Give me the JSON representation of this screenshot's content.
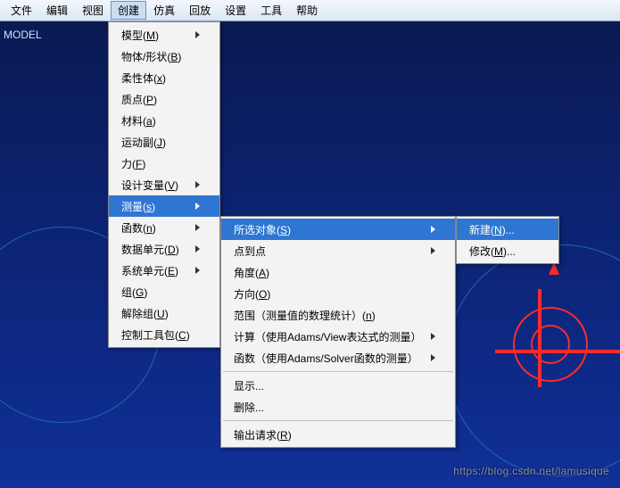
{
  "menubar": {
    "file": "文件",
    "edit": "编辑",
    "view": "视图",
    "create": "创建",
    "simulate": "仿真",
    "playback": "回放",
    "settings": "设置",
    "tools": "工具",
    "help": "帮助"
  },
  "viewport": {
    "model_label": "MODEL"
  },
  "menu_create": {
    "model": {
      "label": "模型",
      "accel": "M"
    },
    "body": {
      "label": "物体/形状",
      "accel": "B"
    },
    "flex": {
      "label": "柔性体",
      "accel": "x"
    },
    "point": {
      "label": "质点",
      "accel": "P"
    },
    "material": {
      "label": "材料",
      "accel": "a"
    },
    "joint": {
      "label": "运动副",
      "accel": "J"
    },
    "force": {
      "label": "力",
      "accel": "F"
    },
    "design_var": {
      "label": "设计变量",
      "accel": "V"
    },
    "measure": {
      "label": "测量",
      "accel": "s"
    },
    "function": {
      "label": "函数",
      "accel": "n"
    },
    "data_elem": {
      "label": "数据单元",
      "accel": "D"
    },
    "sys_elem": {
      "label": "系统单元",
      "accel": "E"
    },
    "group": {
      "label": "组",
      "accel": "G"
    },
    "ungroup": {
      "label": "解除组",
      "accel": "U"
    },
    "ctrl_toolkit": {
      "label": "控制工具包",
      "accel": "C"
    }
  },
  "menu_measure": {
    "selected": {
      "label": "所选对象",
      "accel": "S"
    },
    "p2p": {
      "label": "点到点"
    },
    "angle": {
      "label": "角度",
      "accel": "A"
    },
    "orientation": {
      "label": "方向",
      "accel": "O"
    },
    "range": {
      "label": "范围（测量值的数理统计）",
      "accel": "n"
    },
    "compute_view": {
      "label": "计算（使用Adams/View表达式的测量）"
    },
    "func_solver": {
      "label": "函数（使用Adams/Solver函数的测量）"
    },
    "display": {
      "label": "显示..."
    },
    "delete": {
      "label": "删除..."
    },
    "out_request": {
      "label": "输出请求",
      "accel": "R"
    }
  },
  "menu_selected": {
    "new": {
      "label": "新建",
      "accel": "N",
      "suffix": "..."
    },
    "modify": {
      "label": "修改",
      "accel": "M",
      "suffix": "..."
    }
  },
  "watermark": "https://blog.csdn.net/lamusique"
}
